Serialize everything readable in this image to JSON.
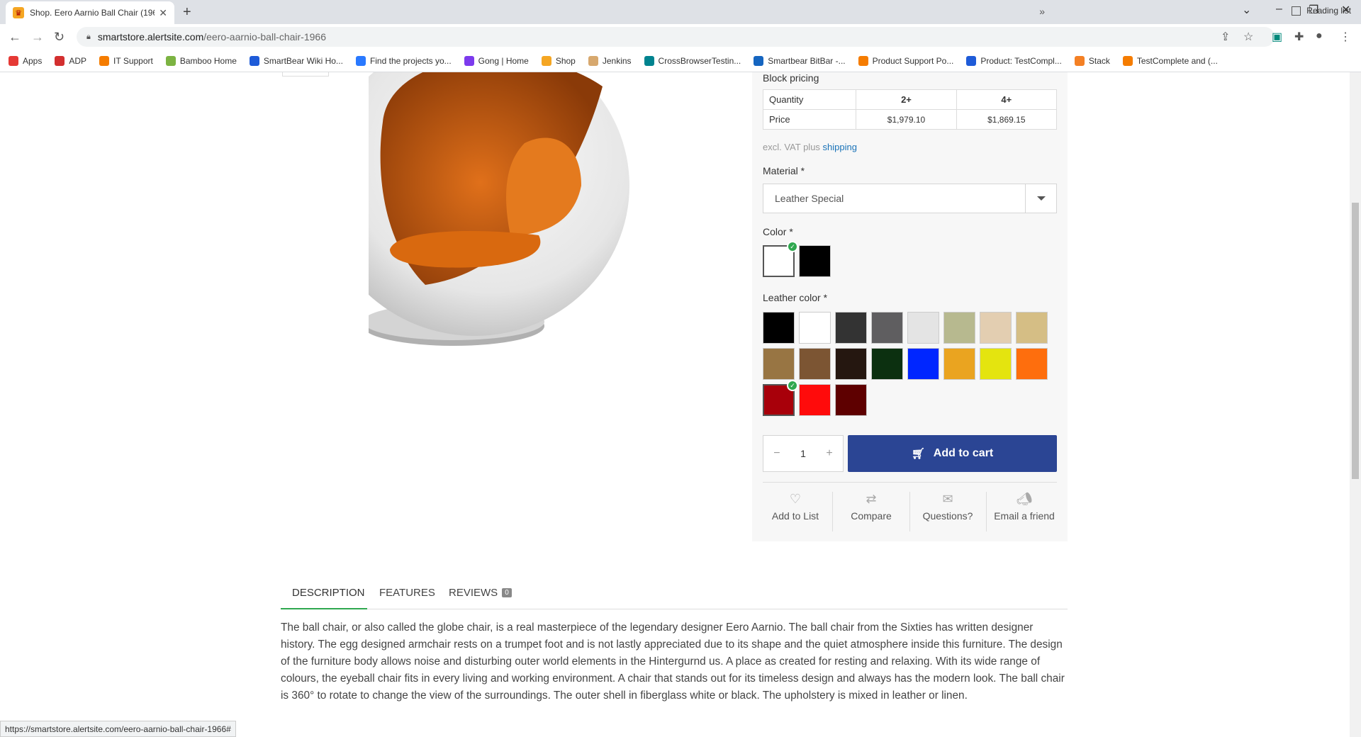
{
  "browser": {
    "tab_title": "Shop. Eero Aarnio Ball Chair (196",
    "url_host": "smartstore.alertsite.com",
    "url_path": "/eero-aarnio-ball-chair-1966",
    "bookmarks": [
      {
        "label": "Apps",
        "color": "#e53935"
      },
      {
        "label": "ADP",
        "color": "#d32f2f"
      },
      {
        "label": "IT Support",
        "color": "#f57c00"
      },
      {
        "label": "Bamboo Home",
        "color": "#7cb342"
      },
      {
        "label": "SmartBear Wiki Ho...",
        "color": "#1e5bd8"
      },
      {
        "label": "Find the projects yo...",
        "color": "#2979ff"
      },
      {
        "label": "Gong | Home",
        "color": "#7c3aed"
      },
      {
        "label": "Shop",
        "color": "#f5a623"
      },
      {
        "label": "Jenkins",
        "color": "#d7a86e"
      },
      {
        "label": "CrossBrowserTestin...",
        "color": "#00838f"
      },
      {
        "label": "Smartbear BitBar -...",
        "color": "#1565c0"
      },
      {
        "label": "Product Support Po...",
        "color": "#f57c00"
      },
      {
        "label": "Product: TestCompl...",
        "color": "#1e5bd8"
      },
      {
        "label": "Stack",
        "color": "#f48024"
      },
      {
        "label": "TestComplete and (...",
        "color": "#f57c00"
      }
    ],
    "reading_list": "Reading list",
    "status_url": "https://smartstore.alertsite.com/eero-aarnio-ball-chair-1966#"
  },
  "product": {
    "block_pricing_label": "Block pricing",
    "table": {
      "row1": [
        "Quantity",
        "2+",
        "4+"
      ],
      "row2": [
        "Price",
        "$1,979.10",
        "$1,869.15"
      ]
    },
    "vat_text": "excl. VAT plus ",
    "shipping_link": "shipping",
    "material_label": "Material *",
    "material_value": "Leather Special",
    "color_label": "Color *",
    "colors": [
      "#ffffff",
      "#000000"
    ],
    "leather_label": "Leather color *",
    "leather_colors": [
      "#000000",
      "#ffffff",
      "#333333",
      "#5f5e60",
      "#e4e4e4",
      "#b7b98f",
      "#e3ceb1",
      "#d5be85",
      "#987543",
      "#7c5533",
      "#251710",
      "#0c3010",
      "#0026ff",
      "#eaa420",
      "#e4e40f",
      "#fe6e0d",
      "#a8000a",
      "#ff0b0b",
      "#5e0000"
    ],
    "quantity": "1",
    "add_to_cart": "Add to cart",
    "actions": [
      "Add to List",
      "Compare",
      "Questions?",
      "Email a friend"
    ]
  },
  "tabs": {
    "description": "DESCRIPTION",
    "features": "FEATURES",
    "reviews": "REVIEWS",
    "reviews_count": "0"
  },
  "description_text": "The ball chair, or also called the globe chair, is a real masterpiece of the legendary designer Eero Aarnio. The ball chair from the Sixties has written designer history. The egg designed armchair rests on a trumpet foot and is not lastly appreciated due to its shape and the quiet atmosphere inside this furniture. The design of the furniture body allows noise and disturbing outer world elements in the Hintergurnd us. A place as created for resting and relaxing. With its wide range of colours, the eyeball chair fits in every living and working environment. A chair that stands out for its timeless design and always has the modern look. The ball chair is 360° to rotate to change the view of the surroundings. The outer shell in fiberglass white or black. The upholstery is mixed in leather or linen."
}
